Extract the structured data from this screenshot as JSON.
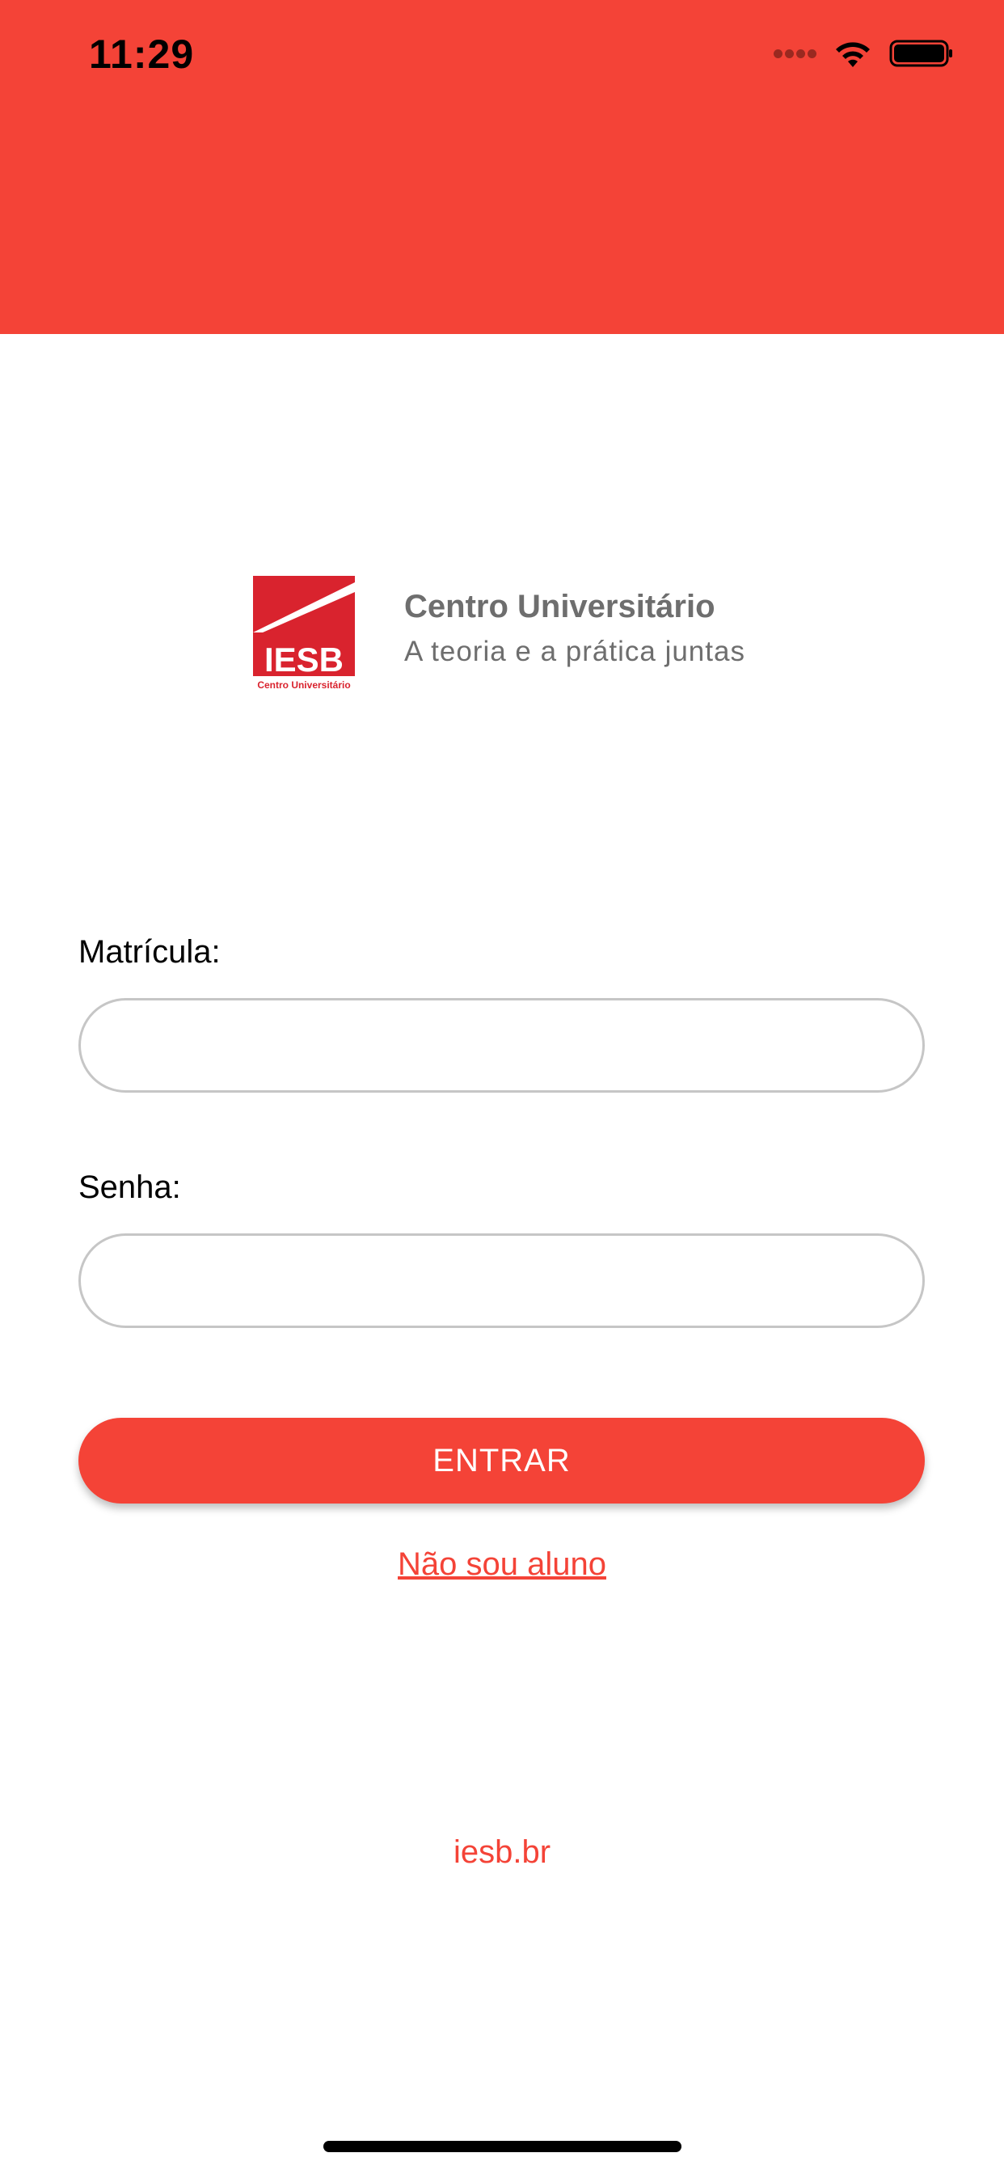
{
  "status_bar": {
    "time": "11:29"
  },
  "colors": {
    "accent": "#f44337",
    "text_gray": "#6e6e6e",
    "input_border": "#c6c6c6"
  },
  "brand": {
    "logo_text": "IESB",
    "logo_caption": "Centro Universitário",
    "title": "Centro Universitário",
    "subtitle": "A teoria e a prática juntas"
  },
  "form": {
    "matricula_label": "Matrícula:",
    "matricula_value": "",
    "senha_label": "Senha:",
    "senha_value": "",
    "submit_label": "ENTRAR"
  },
  "links": {
    "not_student": "Não sou aluno",
    "website": "iesb.br"
  },
  "icons": {
    "signal": "cellular-signal-icon",
    "wifi": "wifi-icon",
    "battery": "battery-icon"
  }
}
